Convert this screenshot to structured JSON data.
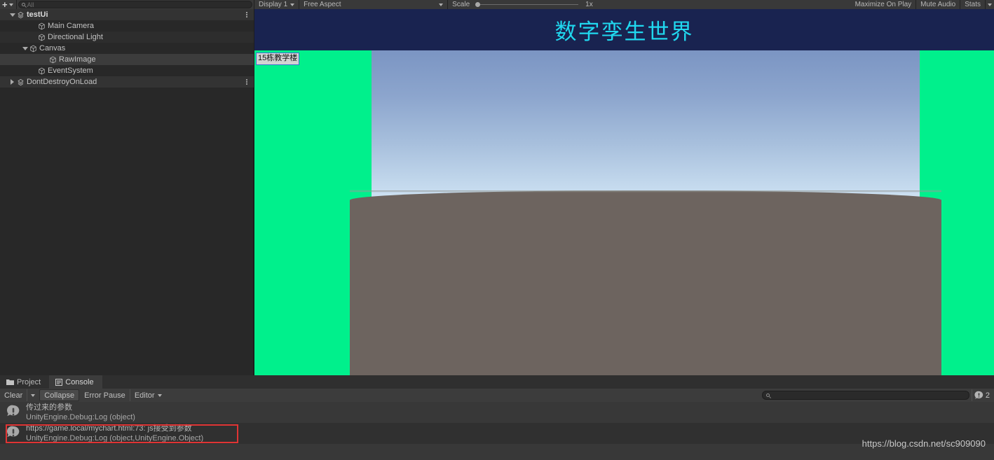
{
  "hierarchy": {
    "add_button_label": "+",
    "search_placeholder": "All",
    "search_icon": "search-icon",
    "rows": [
      {
        "label": "testUi",
        "indent": 12,
        "arrow": "open",
        "icon": "scene-icon",
        "bold": true,
        "kebab": true,
        "style": "hdr"
      },
      {
        "label": "Main Camera",
        "indent": 42,
        "arrow": "none",
        "icon": "gameobject-icon",
        "bold": false,
        "kebab": false,
        "style": "stripe2"
      },
      {
        "label": "Directional Light",
        "indent": 42,
        "arrow": "none",
        "icon": "gameobject-icon",
        "bold": false,
        "kebab": false,
        "style": "stripe"
      },
      {
        "label": "Canvas",
        "indent": 30,
        "arrow": "open",
        "icon": "gameobject-icon",
        "bold": false,
        "kebab": false,
        "style": "stripe2"
      },
      {
        "label": "RawImage",
        "indent": 58,
        "arrow": "none",
        "icon": "gameobject-icon",
        "bold": false,
        "kebab": false,
        "style": "sel"
      },
      {
        "label": "EventSystem",
        "indent": 42,
        "arrow": "none",
        "icon": "gameobject-icon",
        "bold": false,
        "kebab": false,
        "style": "stripe2"
      },
      {
        "label": "DontDestroyOnLoad",
        "indent": 12,
        "arrow": "closed",
        "icon": "scene-icon",
        "bold": false,
        "kebab": true,
        "style": "hdr"
      }
    ]
  },
  "game": {
    "toolbar": {
      "display": "Display 1",
      "aspect": "Free Aspect",
      "scale_label": "Scale",
      "scale_value": "1x",
      "maximize_on_play": "Maximize On Play",
      "mute_audio": "Mute Audio",
      "stats": "Stats"
    },
    "title": "数字孪生世界",
    "title_color": "#20d8ef",
    "title_bg": "#192350",
    "chroma_color": "#00f08c",
    "building_label": "15栋教学楼"
  },
  "console": {
    "tabs": [
      {
        "label": "Project",
        "icon": "folder-icon",
        "active": false
      },
      {
        "label": "Console",
        "icon": "console-icon",
        "active": true
      }
    ],
    "toolbar": {
      "clear": "Clear",
      "collapse": "Collapse",
      "error_pause": "Error Pause",
      "editor": "Editor",
      "search_placeholder": "",
      "search_icon": "search-icon",
      "log_count": "2",
      "log_count_icon": "info-log-icon"
    },
    "entries": [
      {
        "icon": "info-log-icon",
        "message": "传过来的参数",
        "stack": "UnityEngine.Debug:Log (object)",
        "highlighted": false
      },
      {
        "icon": "info-log-icon",
        "message": "https://game.local/mychart.html:73: js接受到参数",
        "stack": "UnityEngine.Debug:Log (object,UnityEngine.Object)",
        "highlighted": true,
        "highlight_color": "#e03434"
      }
    ]
  },
  "watermark": "https://blog.csdn.net/sc909090"
}
